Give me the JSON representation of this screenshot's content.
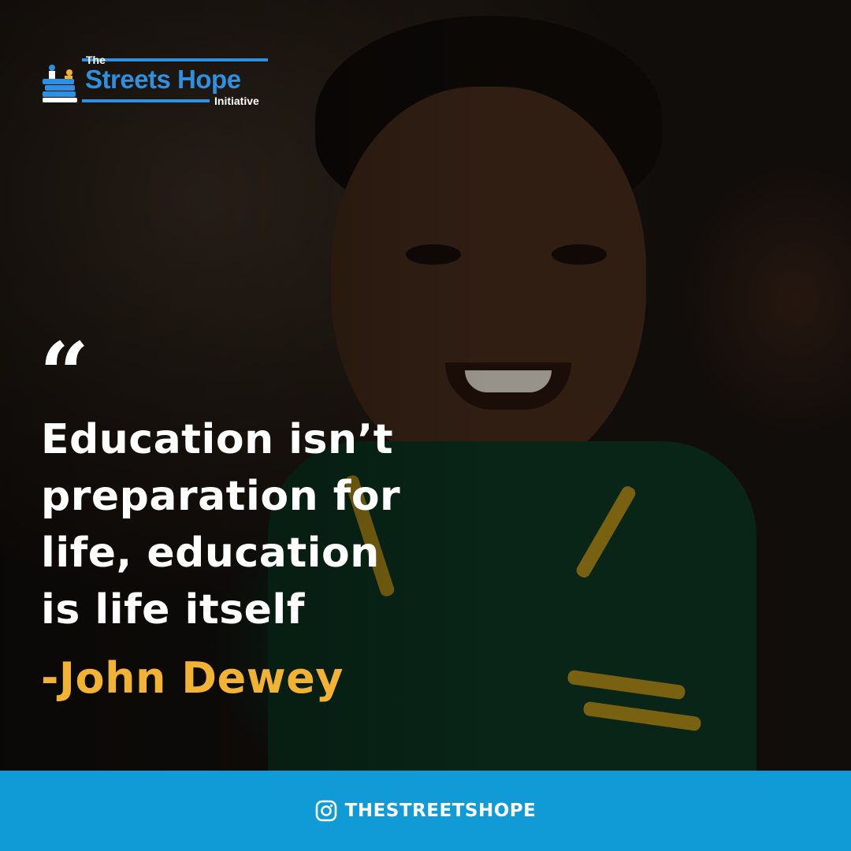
{
  "logo": {
    "the": "The",
    "name": "Streets Hope",
    "initiative": "Initiative"
  },
  "quote": {
    "mark": "“",
    "lines": [
      "Education isn’t",
      "preparation for",
      "life, education",
      "is life itself"
    ],
    "author": "-John Dewey"
  },
  "footer": {
    "icon": "instagram-icon",
    "handle": "THESTREETSHOPE"
  },
  "colors": {
    "accent_blue": "#109bd6",
    "author_yellow": "#f2b233",
    "logo_blue": "#2f8fe0"
  }
}
